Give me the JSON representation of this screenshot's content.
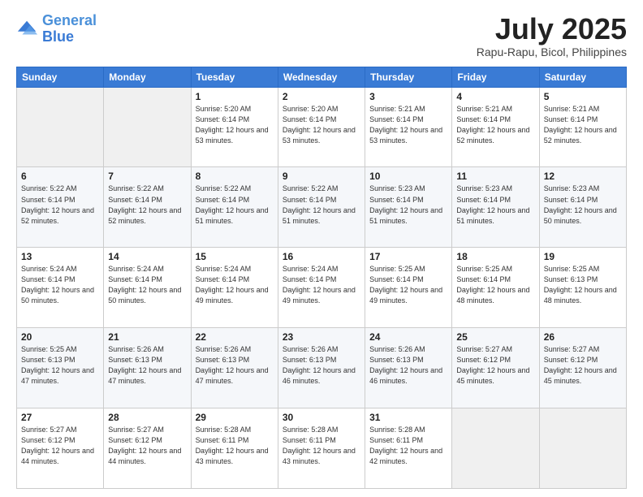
{
  "header": {
    "logo_line1": "General",
    "logo_line2": "Blue",
    "month_year": "July 2025",
    "location": "Rapu-Rapu, Bicol, Philippines"
  },
  "weekdays": [
    "Sunday",
    "Monday",
    "Tuesday",
    "Wednesday",
    "Thursday",
    "Friday",
    "Saturday"
  ],
  "weeks": [
    [
      {
        "day": "",
        "sunrise": "",
        "sunset": "",
        "daylight": ""
      },
      {
        "day": "",
        "sunrise": "",
        "sunset": "",
        "daylight": ""
      },
      {
        "day": "1",
        "sunrise": "Sunrise: 5:20 AM",
        "sunset": "Sunset: 6:14 PM",
        "daylight": "Daylight: 12 hours and 53 minutes."
      },
      {
        "day": "2",
        "sunrise": "Sunrise: 5:20 AM",
        "sunset": "Sunset: 6:14 PM",
        "daylight": "Daylight: 12 hours and 53 minutes."
      },
      {
        "day": "3",
        "sunrise": "Sunrise: 5:21 AM",
        "sunset": "Sunset: 6:14 PM",
        "daylight": "Daylight: 12 hours and 53 minutes."
      },
      {
        "day": "4",
        "sunrise": "Sunrise: 5:21 AM",
        "sunset": "Sunset: 6:14 PM",
        "daylight": "Daylight: 12 hours and 52 minutes."
      },
      {
        "day": "5",
        "sunrise": "Sunrise: 5:21 AM",
        "sunset": "Sunset: 6:14 PM",
        "daylight": "Daylight: 12 hours and 52 minutes."
      }
    ],
    [
      {
        "day": "6",
        "sunrise": "Sunrise: 5:22 AM",
        "sunset": "Sunset: 6:14 PM",
        "daylight": "Daylight: 12 hours and 52 minutes."
      },
      {
        "day": "7",
        "sunrise": "Sunrise: 5:22 AM",
        "sunset": "Sunset: 6:14 PM",
        "daylight": "Daylight: 12 hours and 52 minutes."
      },
      {
        "day": "8",
        "sunrise": "Sunrise: 5:22 AM",
        "sunset": "Sunset: 6:14 PM",
        "daylight": "Daylight: 12 hours and 51 minutes."
      },
      {
        "day": "9",
        "sunrise": "Sunrise: 5:22 AM",
        "sunset": "Sunset: 6:14 PM",
        "daylight": "Daylight: 12 hours and 51 minutes."
      },
      {
        "day": "10",
        "sunrise": "Sunrise: 5:23 AM",
        "sunset": "Sunset: 6:14 PM",
        "daylight": "Daylight: 12 hours and 51 minutes."
      },
      {
        "day": "11",
        "sunrise": "Sunrise: 5:23 AM",
        "sunset": "Sunset: 6:14 PM",
        "daylight": "Daylight: 12 hours and 51 minutes."
      },
      {
        "day": "12",
        "sunrise": "Sunrise: 5:23 AM",
        "sunset": "Sunset: 6:14 PM",
        "daylight": "Daylight: 12 hours and 50 minutes."
      }
    ],
    [
      {
        "day": "13",
        "sunrise": "Sunrise: 5:24 AM",
        "sunset": "Sunset: 6:14 PM",
        "daylight": "Daylight: 12 hours and 50 minutes."
      },
      {
        "day": "14",
        "sunrise": "Sunrise: 5:24 AM",
        "sunset": "Sunset: 6:14 PM",
        "daylight": "Daylight: 12 hours and 50 minutes."
      },
      {
        "day": "15",
        "sunrise": "Sunrise: 5:24 AM",
        "sunset": "Sunset: 6:14 PM",
        "daylight": "Daylight: 12 hours and 49 minutes."
      },
      {
        "day": "16",
        "sunrise": "Sunrise: 5:24 AM",
        "sunset": "Sunset: 6:14 PM",
        "daylight": "Daylight: 12 hours and 49 minutes."
      },
      {
        "day": "17",
        "sunrise": "Sunrise: 5:25 AM",
        "sunset": "Sunset: 6:14 PM",
        "daylight": "Daylight: 12 hours and 49 minutes."
      },
      {
        "day": "18",
        "sunrise": "Sunrise: 5:25 AM",
        "sunset": "Sunset: 6:14 PM",
        "daylight": "Daylight: 12 hours and 48 minutes."
      },
      {
        "day": "19",
        "sunrise": "Sunrise: 5:25 AM",
        "sunset": "Sunset: 6:13 PM",
        "daylight": "Daylight: 12 hours and 48 minutes."
      }
    ],
    [
      {
        "day": "20",
        "sunrise": "Sunrise: 5:25 AM",
        "sunset": "Sunset: 6:13 PM",
        "daylight": "Daylight: 12 hours and 47 minutes."
      },
      {
        "day": "21",
        "sunrise": "Sunrise: 5:26 AM",
        "sunset": "Sunset: 6:13 PM",
        "daylight": "Daylight: 12 hours and 47 minutes."
      },
      {
        "day": "22",
        "sunrise": "Sunrise: 5:26 AM",
        "sunset": "Sunset: 6:13 PM",
        "daylight": "Daylight: 12 hours and 47 minutes."
      },
      {
        "day": "23",
        "sunrise": "Sunrise: 5:26 AM",
        "sunset": "Sunset: 6:13 PM",
        "daylight": "Daylight: 12 hours and 46 minutes."
      },
      {
        "day": "24",
        "sunrise": "Sunrise: 5:26 AM",
        "sunset": "Sunset: 6:13 PM",
        "daylight": "Daylight: 12 hours and 46 minutes."
      },
      {
        "day": "25",
        "sunrise": "Sunrise: 5:27 AM",
        "sunset": "Sunset: 6:12 PM",
        "daylight": "Daylight: 12 hours and 45 minutes."
      },
      {
        "day": "26",
        "sunrise": "Sunrise: 5:27 AM",
        "sunset": "Sunset: 6:12 PM",
        "daylight": "Daylight: 12 hours and 45 minutes."
      }
    ],
    [
      {
        "day": "27",
        "sunrise": "Sunrise: 5:27 AM",
        "sunset": "Sunset: 6:12 PM",
        "daylight": "Daylight: 12 hours and 44 minutes."
      },
      {
        "day": "28",
        "sunrise": "Sunrise: 5:27 AM",
        "sunset": "Sunset: 6:12 PM",
        "daylight": "Daylight: 12 hours and 44 minutes."
      },
      {
        "day": "29",
        "sunrise": "Sunrise: 5:28 AM",
        "sunset": "Sunset: 6:11 PM",
        "daylight": "Daylight: 12 hours and 43 minutes."
      },
      {
        "day": "30",
        "sunrise": "Sunrise: 5:28 AM",
        "sunset": "Sunset: 6:11 PM",
        "daylight": "Daylight: 12 hours and 43 minutes."
      },
      {
        "day": "31",
        "sunrise": "Sunrise: 5:28 AM",
        "sunset": "Sunset: 6:11 PM",
        "daylight": "Daylight: 12 hours and 42 minutes."
      },
      {
        "day": "",
        "sunrise": "",
        "sunset": "",
        "daylight": ""
      },
      {
        "day": "",
        "sunrise": "",
        "sunset": "",
        "daylight": ""
      }
    ]
  ]
}
